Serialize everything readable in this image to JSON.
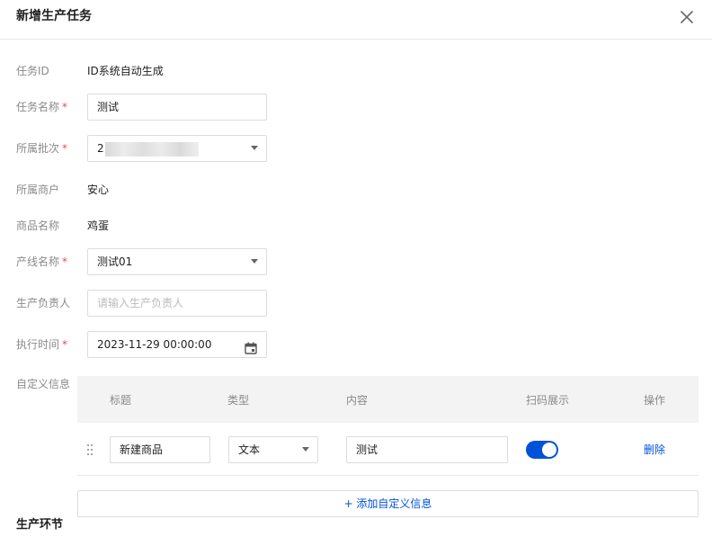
{
  "dialog": {
    "title": "新增生产任务",
    "close_icon": "close-icon"
  },
  "form": {
    "task_id": {
      "label": "任务ID",
      "value": "ID系统自动生成"
    },
    "task_name": {
      "label": "任务名称",
      "required": "*",
      "value": "测试"
    },
    "batch": {
      "label": "所属批次",
      "required": "*",
      "value": "2"
    },
    "merchant": {
      "label": "所属商户",
      "value": "安心"
    },
    "product": {
      "label": "商品名称",
      "value": "鸡蛋"
    },
    "line": {
      "label": "产线名称",
      "required": "*",
      "value": "测试01"
    },
    "owner": {
      "label": "生产负责人",
      "placeholder": "请输入生产负责人"
    },
    "exec_time": {
      "label": "执行时间",
      "required": "*",
      "value": "2023-11-29 00:00:00"
    },
    "custom_info": {
      "label": "自定义信息"
    }
  },
  "custom_table": {
    "headers": {
      "title": "标题",
      "type": "类型",
      "content": "内容",
      "scan_display": "扫码展示",
      "action": "操作"
    },
    "rows": [
      {
        "title": "新建商品",
        "type": "文本",
        "content": "测试",
        "scan_display": true,
        "action": "删除"
      }
    ],
    "add_label": "+ 添加自定义信息"
  },
  "next_section": {
    "title": "生产环节"
  },
  "colors": {
    "accent": "#0052d9",
    "required": "#e34d59",
    "label": "#8a8a8a"
  }
}
